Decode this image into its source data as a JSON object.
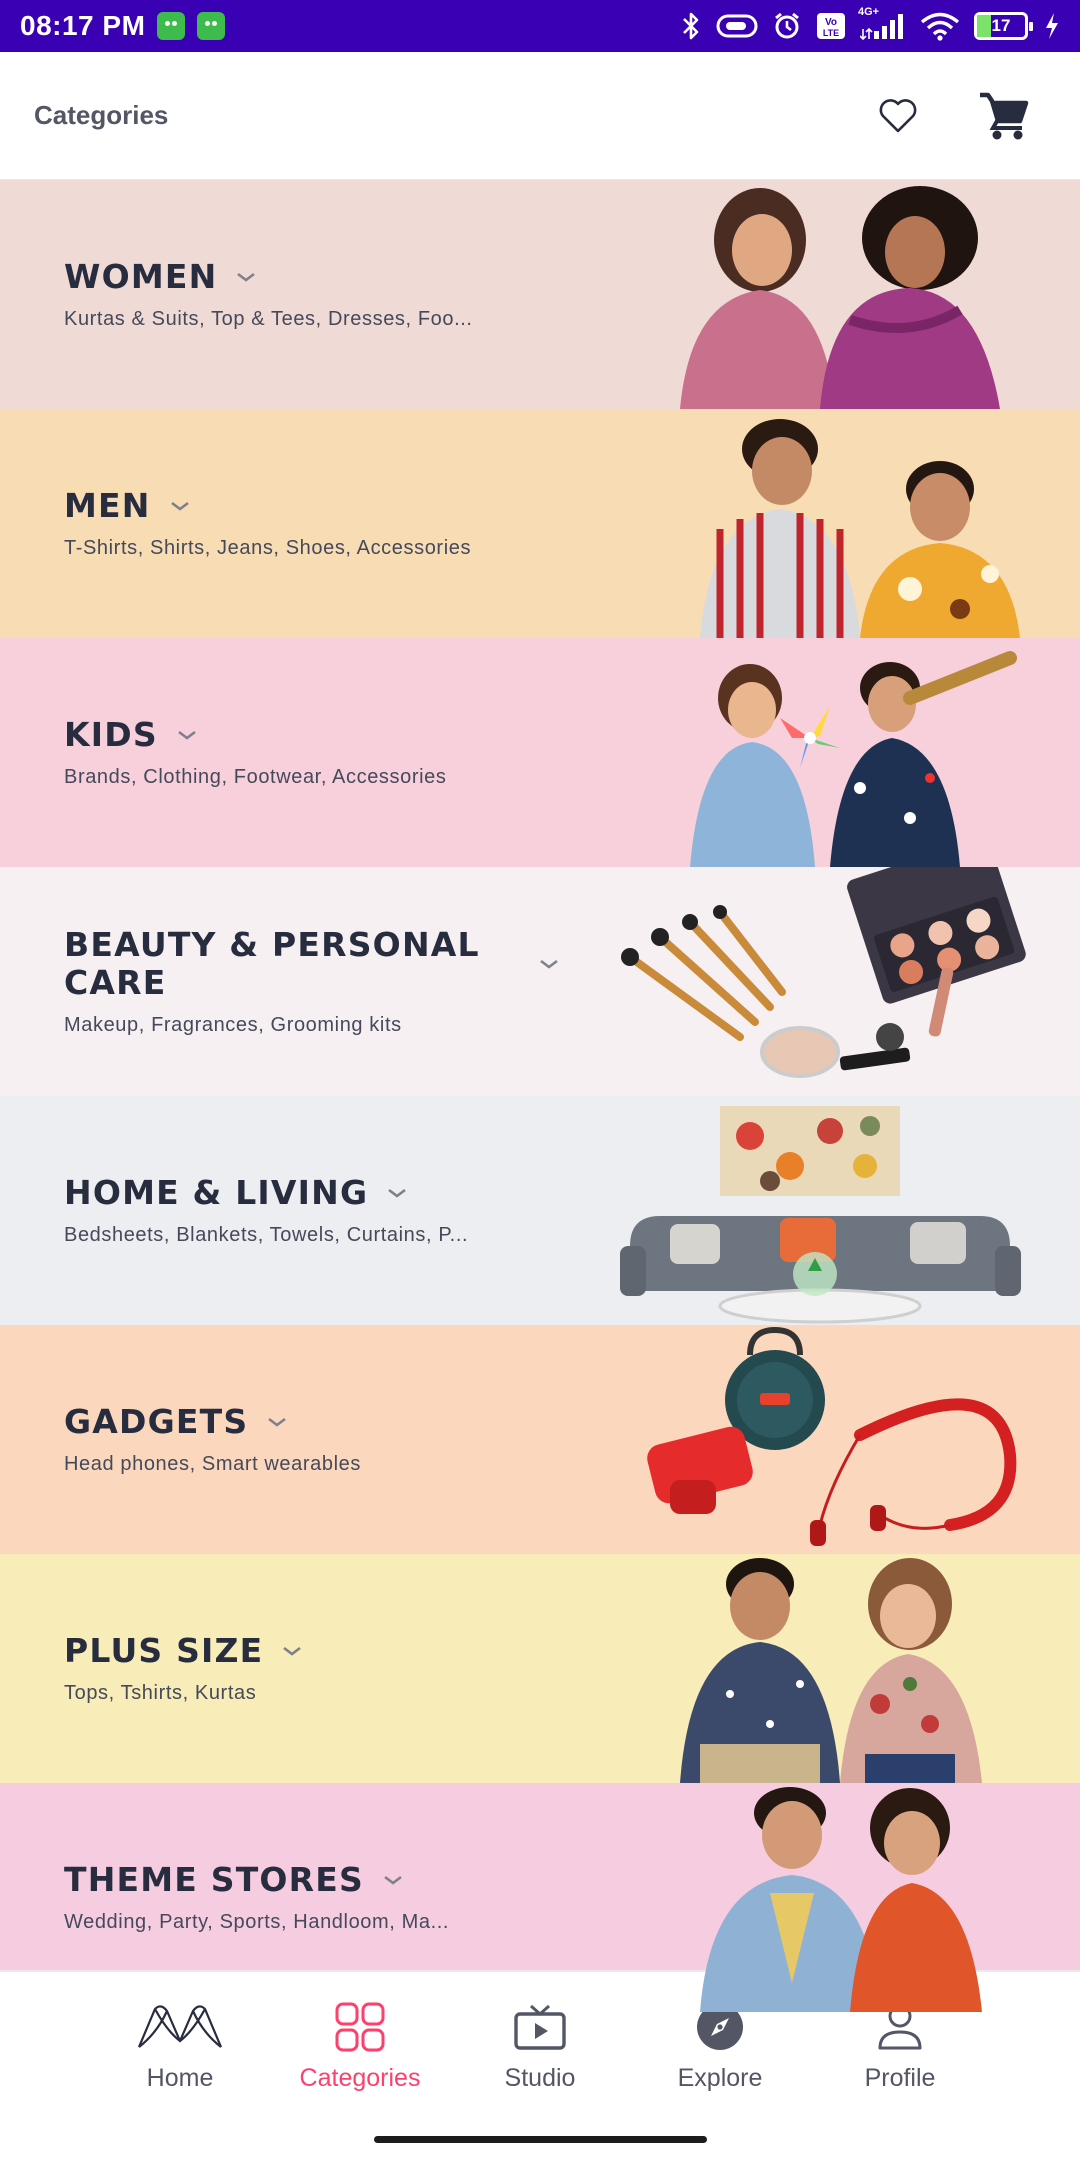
{
  "status_bar": {
    "time": "08:17 PM",
    "network_badge": "4G+",
    "battery_level": "17"
  },
  "header": {
    "title": "Categories"
  },
  "categories": [
    {
      "name": "WOMEN",
      "subtitle": "Kurtas & Suits, Top & Tees, Dresses, Foo...",
      "bg": "#f0dad6"
    },
    {
      "name": "MEN",
      "subtitle": "T-Shirts, Shirts, Jeans, Shoes, Accessories",
      "bg": "#f8dcb4"
    },
    {
      "name": "KIDS",
      "subtitle": "Brands, Clothing, Footwear, Accessories",
      "bg": "#f7d0dc"
    },
    {
      "name": "BEAUTY & PERSONAL CARE",
      "subtitle": "Makeup, Fragrances, Grooming kits",
      "bg": "#f6f0f3"
    },
    {
      "name": "HOME & LIVING",
      "subtitle": "Bedsheets, Blankets, Towels, Curtains, P...",
      "bg": "#eceef1"
    },
    {
      "name": "GADGETS",
      "subtitle": "Head phones, Smart wearables",
      "bg": "#fbd8bd"
    },
    {
      "name": "PLUS SIZE",
      "subtitle": "Tops, Tshirts, Kurtas",
      "bg": "#f8ecb9"
    },
    {
      "name": "THEME STORES",
      "subtitle": "Wedding, Party, Sports, Handloom, Ma...",
      "bg": "#f6cde0"
    }
  ],
  "bottom_nav": {
    "items": [
      {
        "label": "Home",
        "icon": "myntra-logo-icon",
        "active": false
      },
      {
        "label": "Categories",
        "icon": "grid-icon",
        "active": true
      },
      {
        "label": "Studio",
        "icon": "tv-play-icon",
        "active": false
      },
      {
        "label": "Explore",
        "icon": "compass-icon",
        "active": false
      },
      {
        "label": "Profile",
        "icon": "user-icon",
        "active": false
      }
    ]
  },
  "colors": {
    "status_bar": "#3a00b4",
    "accent": "#ff3f6c",
    "text_dark": "#282c3f",
    "text_muted": "#535665"
  }
}
